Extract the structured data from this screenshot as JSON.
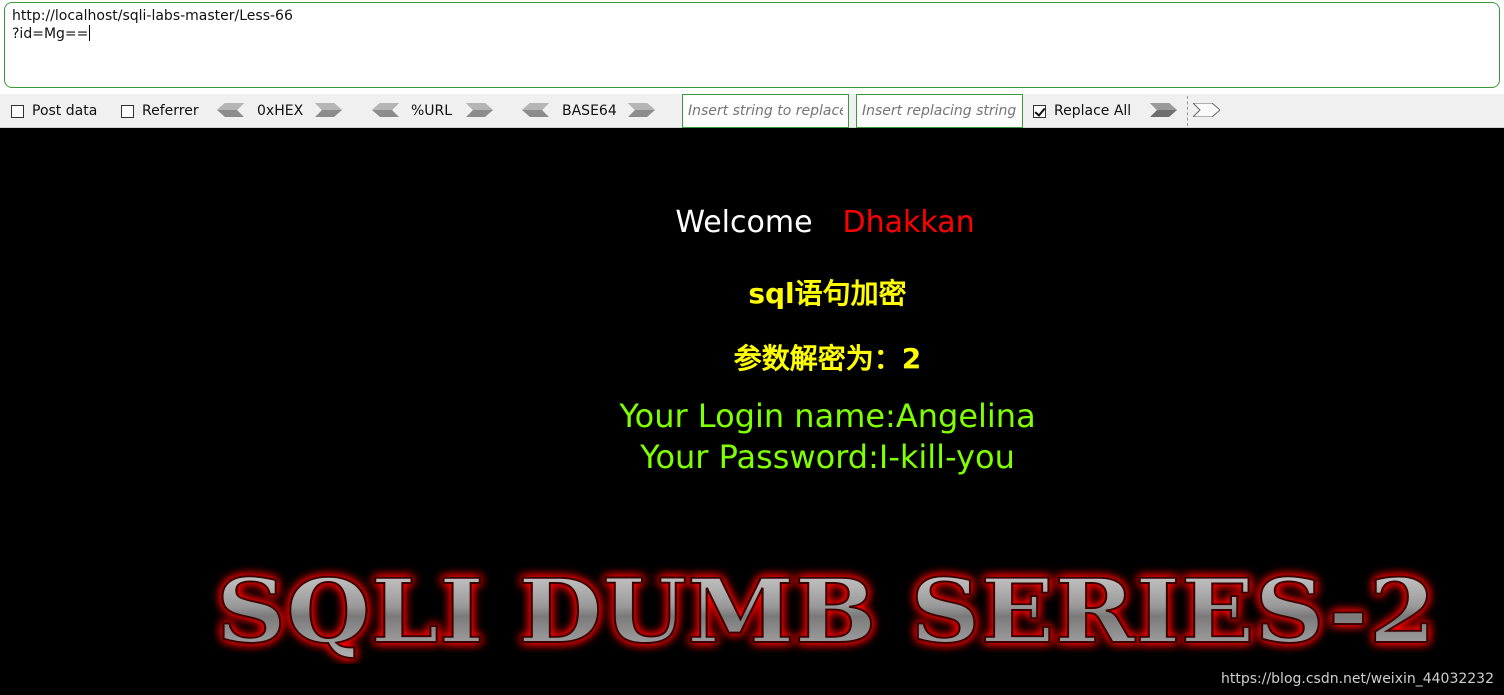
{
  "url_bar": {
    "line1": "http://localhost/sqli-labs-master/Less-66",
    "line2": "?id=Mg=="
  },
  "toolbar": {
    "post_data": "Post data",
    "referrer": "Referrer",
    "hex": "0xHEX",
    "url": "%URL",
    "base64": "BASE64",
    "find_placeholder": "Insert string to replace",
    "replace_placeholder": "Insert replacing string",
    "replace_all": "Replace All",
    "replace_all_checked": true
  },
  "page": {
    "welcome": "Welcome",
    "user": "Dhakkan",
    "heading": "sql语句加密",
    "param": "参数解密为：2",
    "login_name": "Your Login name:Angelina",
    "password": "Your Password:I-kill-you",
    "banner": "SQLI DUMB SERIES-2"
  },
  "watermark": "https://blog.csdn.net/weixin_44032232",
  "colors": {
    "background": "#000000",
    "welcome": "#ffffff",
    "user": "#ff0000",
    "yellow_text": "#ffff00",
    "green_text": "#7fff00",
    "input_border": "#3a9a3a"
  }
}
